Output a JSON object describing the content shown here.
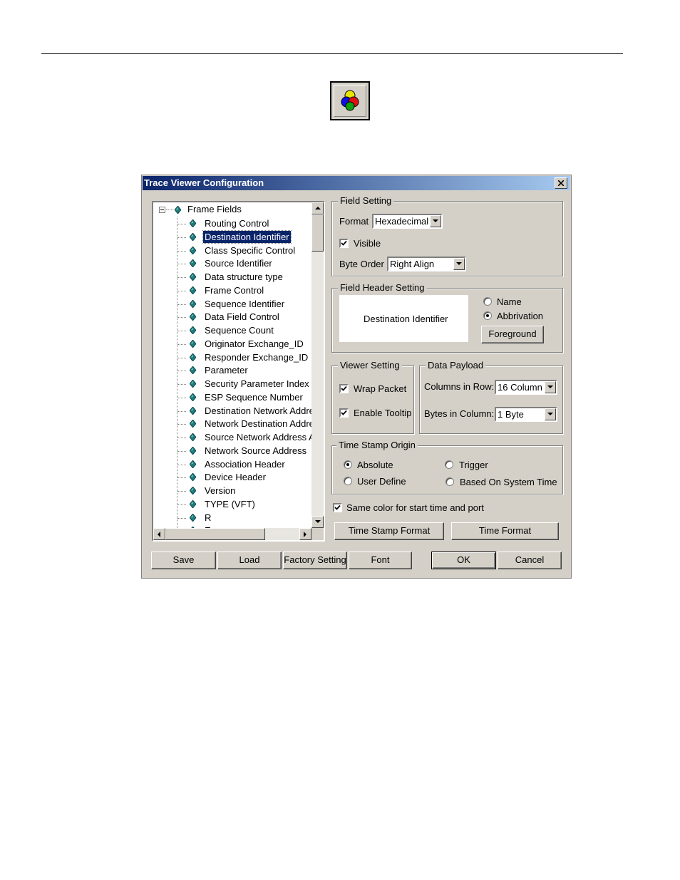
{
  "dialog": {
    "title": "Trace Viewer Configuration"
  },
  "tree": {
    "root_label": "Frame Fields",
    "selected_index": 1,
    "items": [
      "Routing Control",
      "Destination Identifier",
      "Class Specific Control",
      "Source Identifier",
      "Data structure type",
      "Frame Control",
      "Sequence Identifier",
      "Data Field Control",
      "Sequence Count",
      "Originator Exchange_ID",
      "Responder Exchange_ID",
      "Parameter",
      "Security Parameter Index",
      "ESP Sequence Number",
      "Destination Network Addre",
      "Network Destination Addre",
      "Source Network Address A",
      "Network Source Address",
      "Association Header",
      "Device Header",
      "Version",
      "TYPE (VFT)",
      "R",
      "E"
    ],
    "icon_color": "#1e7b7b"
  },
  "field_setting": {
    "legend": "Field Setting",
    "format_label": "Format",
    "format_value": "Hexadecimal",
    "visible_label": "Visible",
    "visible_checked": true,
    "byte_order_label": "Byte Order",
    "byte_order_value": "Right Align"
  },
  "field_header_setting": {
    "legend": "Field Header Setting",
    "preview_text": "Destination Identifier",
    "name_label": "Name",
    "abbrivation_label": "Abbrivation",
    "selected": "abbrivation",
    "foreground_button": "Foreground"
  },
  "viewer_setting": {
    "legend": "Viewer Setting",
    "wrap_packet_label": "Wrap Packet",
    "wrap_packet_checked": true,
    "enable_tooltip_label": "Enable Tooltip",
    "enable_tooltip_checked": true
  },
  "data_payload": {
    "legend": "Data Payload",
    "columns_label": "Columns in Row:",
    "columns_value": "16  Column",
    "bytes_label": "Bytes in Column:",
    "bytes_value": "1  Byte"
  },
  "time_stamp_origin": {
    "legend": "Time Stamp Origin",
    "absolute_label": "Absolute",
    "trigger_label": "Trigger",
    "user_define_label": "User Define",
    "system_time_label": "Based On System Time",
    "selected": "absolute"
  },
  "same_color": {
    "label": "Same color for start time and port",
    "checked": true
  },
  "buttons": {
    "time_stamp_format": "Time Stamp Format",
    "time_format": "Time Format",
    "save": "Save",
    "load": "Load",
    "factory_setting": "Factory Setting",
    "font": "Font",
    "ok": "OK",
    "cancel": "Cancel"
  },
  "colors": {
    "title_gradient_start": "#0a246a",
    "title_gradient_end": "#a6caf0",
    "dialog_face": "#d4d0c8",
    "selection": "#0a246a"
  }
}
